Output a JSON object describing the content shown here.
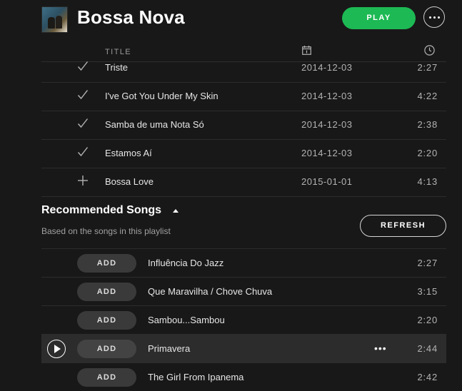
{
  "playlist": {
    "title": "Bossa Nova",
    "play_label": "PLAY"
  },
  "columns": {
    "title": "TITLE"
  },
  "tracks": [
    {
      "status": "check",
      "name": "Triste",
      "date": "2014-12-03",
      "duration": "2:27"
    },
    {
      "status": "check",
      "name": "I've Got You Under My Skin",
      "date": "2014-12-03",
      "duration": "4:22"
    },
    {
      "status": "check",
      "name": "Samba de uma Nota Só",
      "date": "2014-12-03",
      "duration": "2:38"
    },
    {
      "status": "check",
      "name": "Estamos Aí",
      "date": "2014-12-03",
      "duration": "2:20"
    },
    {
      "status": "add",
      "name": "Bossa Love",
      "date": "2015-01-01",
      "duration": "4:13"
    }
  ],
  "recommended": {
    "title": "Recommended Songs",
    "subtitle": "Based on the songs in this playlist",
    "refresh_label": "REFRESH",
    "add_label": "ADD",
    "songs": [
      {
        "name": "Influência Do Jazz",
        "duration": "2:27"
      },
      {
        "name": "Que Maravilha / Chove Chuva",
        "duration": "3:15"
      },
      {
        "name": "Sambou...Sambou",
        "duration": "2:20"
      },
      {
        "name": "Primavera",
        "duration": "2:44",
        "hovered": true
      },
      {
        "name": "The Girl From Ipanema",
        "duration": "2:42"
      }
    ]
  },
  "colors": {
    "accent": "#1db954",
    "background": "#181818",
    "row_hover": "#2c2c2c"
  },
  "icons": {
    "track_added": "check-icon",
    "track_not_added": "plus-icon",
    "date_column": "calendar-icon",
    "duration_column": "clock-icon"
  }
}
